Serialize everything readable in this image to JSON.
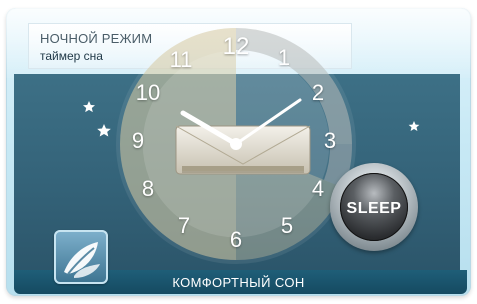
{
  "header": {
    "mode_title": "НОЧНОЙ РЕЖИМ",
    "subtitle": "таймер сна"
  },
  "clock": {
    "numbers": [
      "12",
      "1",
      "2",
      "3",
      "4",
      "5",
      "6",
      "7",
      "8",
      "9",
      "10",
      "11"
    ],
    "hour_hand_points_to": 10,
    "minute_hand_points_to": 2
  },
  "sleep_button": {
    "label": "SLEEP"
  },
  "footer": {
    "label": "КОМФОРТНЫЙ СОН"
  },
  "icons": {
    "moon": "moon-icon",
    "star": "star-icon",
    "leaf": "leaf-icon",
    "ac_unit": "air-conditioner-icon"
  },
  "colors": {
    "panel": "#346379",
    "footer": "#1a5670",
    "frame": "#c8e9f5",
    "sleep_sector": "#d6c9a0"
  }
}
